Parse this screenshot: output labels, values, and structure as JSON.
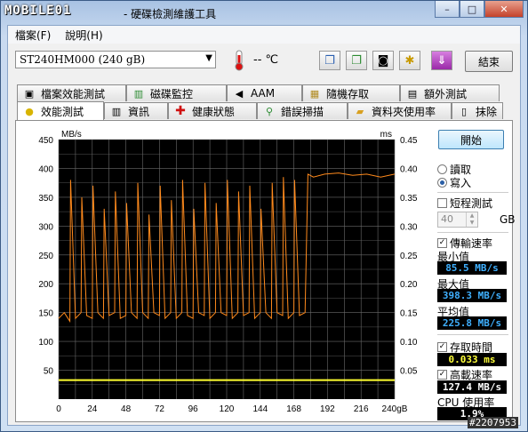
{
  "window": {
    "logo_text": "MOBILE01",
    "title": "- 硬碟檢測維護工具",
    "min_symbol": "–",
    "max_symbol": "□",
    "close_symbol": "✕"
  },
  "menu": {
    "items": [
      "檔案(F)",
      "說明(H)"
    ]
  },
  "toolbar": {
    "drive": "ST240HM000 (240 gB)",
    "temperature": "-- ℃",
    "exit_label": "結束",
    "icons": [
      "copy-icon",
      "copy-green-icon",
      "camera-icon",
      "settings-icon",
      "download-icon"
    ]
  },
  "tabs": {
    "row1": [
      {
        "label": "檔案效能測試",
        "icon": "file-benchmark-icon"
      },
      {
        "label": "磁碟監控",
        "icon": "disk-monitor-icon"
      },
      {
        "label": "AAM",
        "icon": "speaker-icon"
      },
      {
        "label": "隨機存取",
        "icon": "random-access-icon"
      },
      {
        "label": "額外測試",
        "icon": "extra-tests-icon"
      }
    ],
    "row2": [
      {
        "label": "效能測試",
        "icon": "lightbulb-icon",
        "active": true
      },
      {
        "label": "資訊",
        "icon": "info-icon"
      },
      {
        "label": "健康狀態",
        "icon": "health-cross-icon"
      },
      {
        "label": "錯誤掃描",
        "icon": "magnifier-icon"
      },
      {
        "label": "資料夾使用率",
        "icon": "folder-icon"
      },
      {
        "label": "抹除",
        "icon": "trash-icon"
      }
    ]
  },
  "side": {
    "start_label": "開始",
    "radio_read": "讀取",
    "radio_write": "寫入",
    "short_test": "短程測試",
    "spin_value": "40",
    "spin_unit": "GB",
    "transfer_rate": "傳輸速率",
    "min_label": "最小值",
    "min_value": "85.5 MB/s",
    "max_label": "最大值",
    "max_value": "398.3 MB/s",
    "avg_label": "平均值",
    "avg_value": "225.8 MB/s",
    "access_time": "存取時間",
    "access_value": "0.033 ms",
    "burst_rate": "高載速率",
    "burst_value": "127.4 MB/s",
    "cpu_label": "CPU 使用率",
    "cpu_value": "1.9%"
  },
  "watermark": "#2207953",
  "chart_data": {
    "type": "line",
    "ylabel_left": "MB/s",
    "ylabel_right": "ms",
    "ylim_left": [
      0,
      450
    ],
    "ylim_right": [
      0,
      0.45
    ],
    "yticks_left": [
      50,
      100,
      150,
      200,
      250,
      300,
      350,
      400,
      450
    ],
    "yticks_right": [
      "0.05",
      "0.10",
      "0.15",
      "0.20",
      "0.25",
      "0.30",
      "0.35",
      "0.40",
      "0.45"
    ],
    "xticks": [
      "0",
      "24",
      "48",
      "72",
      "96",
      "120",
      "144",
      "168",
      "192",
      "216",
      "240gB"
    ],
    "xlim": [
      0,
      240
    ],
    "grid": true,
    "colors": {
      "background": "#000000",
      "grid": "#6a6a6a",
      "transfer": "#ff8a1c",
      "access": "#ffff30"
    },
    "series": [
      {
        "name": "transfer",
        "x": [
          0,
          4,
          8,
          8.5,
          12,
          16,
          16.5,
          20,
          24,
          24.5,
          28,
          32,
          32.5,
          36,
          40,
          40.5,
          44,
          48,
          48.5,
          52,
          56,
          56.5,
          60,
          64,
          64.5,
          68,
          72,
          72.5,
          76,
          80,
          80.5,
          84,
          88,
          88.5,
          92,
          96,
          96.5,
          100,
          104,
          104.5,
          108,
          112,
          112.5,
          116,
          120,
          120.5,
          124,
          128,
          128.5,
          132,
          136,
          136.5,
          140,
          144,
          144.5,
          148,
          152,
          152.5,
          156,
          160,
          160.5,
          164,
          168,
          168.5,
          172,
          176,
          178,
          182,
          190,
          200,
          210,
          220,
          230,
          240
        ],
        "values": [
          140,
          150,
          135,
          380,
          140,
          150,
          350,
          145,
          140,
          370,
          150,
          140,
          330,
          145,
          150,
          360,
          140,
          145,
          340,
          150,
          140,
          375,
          150,
          140,
          320,
          150,
          145,
          370,
          140,
          150,
          345,
          140,
          150,
          380,
          145,
          140,
          330,
          150,
          145,
          375,
          140,
          150,
          340,
          150,
          145,
          380,
          140,
          150,
          360,
          145,
          150,
          370,
          140,
          150,
          330,
          150,
          140,
          375,
          150,
          145,
          385,
          140,
          150,
          380,
          145,
          150,
          390,
          385,
          390,
          392,
          388,
          390,
          385,
          390
        ]
      },
      {
        "name": "access",
        "x": [
          0,
          240
        ],
        "values": [
          0.033,
          0.033
        ]
      }
    ]
  }
}
